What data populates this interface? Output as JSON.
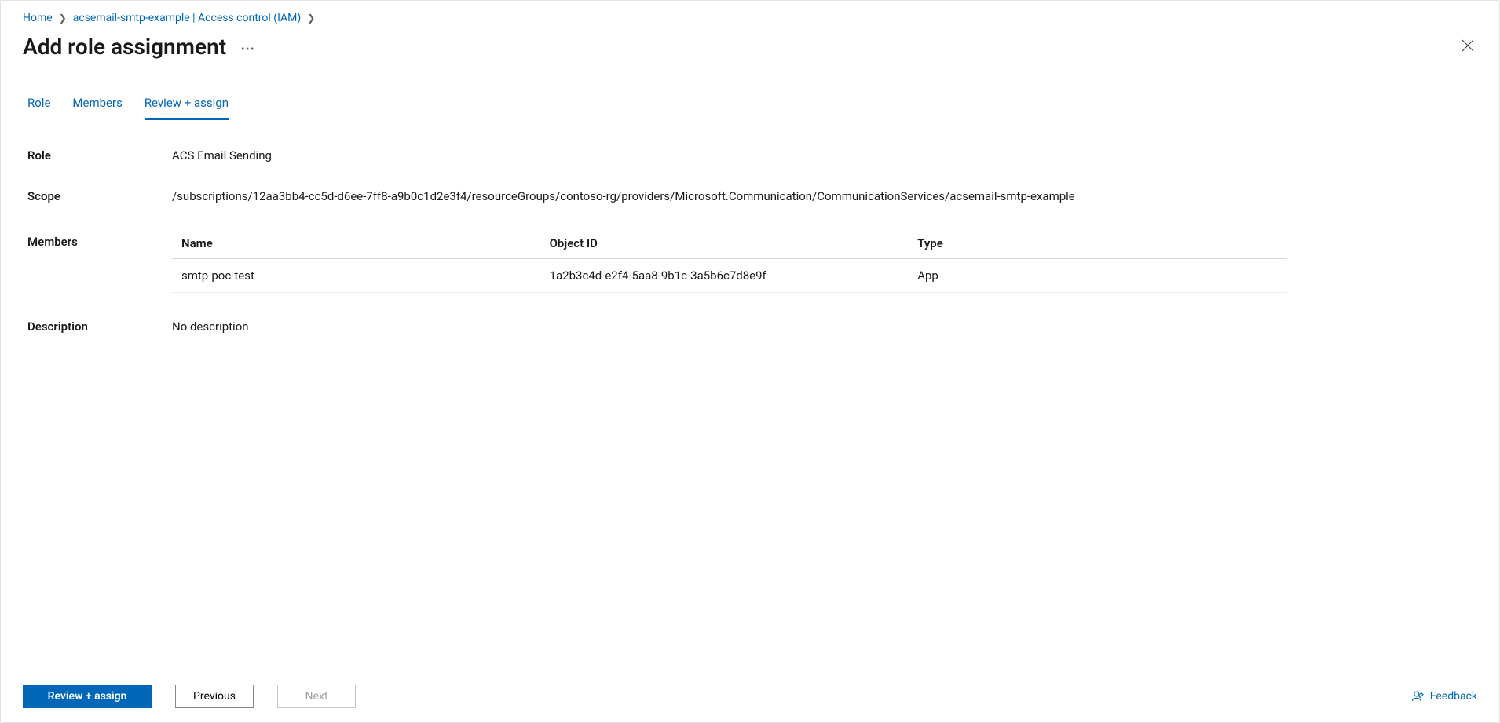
{
  "breadcrumb": {
    "home": "Home",
    "resource": "acsemail-smtp-example | Access control (IAM)"
  },
  "header": {
    "title": "Add role assignment"
  },
  "tabs": {
    "role": "Role",
    "members": "Members",
    "review": "Review + assign"
  },
  "fields": {
    "role_label": "Role",
    "role_value": "ACS Email Sending",
    "scope_label": "Scope",
    "scope_value": "/subscriptions/12aa3bb4-cc5d-d6ee-7ff8-a9b0c1d2e3f4/resourceGroups/contoso-rg/providers/Microsoft.Communication/CommunicationServices/acsemail-smtp-example",
    "members_label": "Members",
    "description_label": "Description",
    "description_value": "No description"
  },
  "members_table": {
    "headers": {
      "name": "Name",
      "object_id": "Object ID",
      "type": "Type"
    },
    "rows": [
      {
        "name": "smtp-poc-test",
        "object_id": "1a2b3c4d-e2f4-5aa8-9b1c-3a5b6c7d8e9f",
        "type": "App"
      }
    ]
  },
  "footer": {
    "review_assign": "Review + assign",
    "previous": "Previous",
    "next": "Next",
    "feedback": "Feedback"
  }
}
